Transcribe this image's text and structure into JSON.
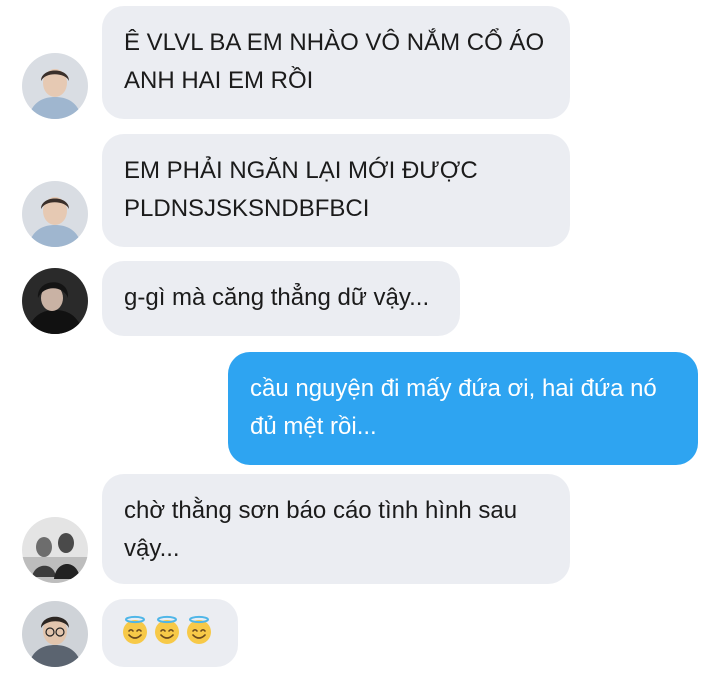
{
  "messages": [
    {
      "id": "m1",
      "direction": "incoming",
      "lines": [
        "Ê VLVL BA EM NHÀO VÔ NẮM CỔ ÁO",
        "ANH HAI EM RỒI"
      ]
    },
    {
      "id": "m2",
      "direction": "incoming",
      "lines": [
        "EM PHẢI NGĂN LẠI MỚI ĐƯỢC",
        "PLDNSJSKSNDBFBCI"
      ]
    },
    {
      "id": "m3",
      "direction": "incoming",
      "lines": [
        "g-gì mà căng thẳng dữ vậy..."
      ]
    },
    {
      "id": "m4",
      "direction": "outgoing",
      "lines": [
        "cầu nguyện đi mấy đứa ơi, hai đứa nó",
        "đủ mệt rồi..."
      ]
    },
    {
      "id": "m5",
      "direction": "incoming",
      "lines": [
        "chờ thằng sơn báo cáo tình hình sau",
        "vậy..."
      ]
    },
    {
      "id": "m6",
      "direction": "incoming",
      "emoji": [
        "smiling-face-with-halo",
        "smiling-face-with-halo",
        "smiling-face-with-halo"
      ]
    }
  ],
  "colors": {
    "incoming_bubble": "#ebedf2",
    "outgoing_bubble": "#2ea4f1",
    "incoming_text": "#1b1b1b",
    "outgoing_text": "#ffffff"
  }
}
